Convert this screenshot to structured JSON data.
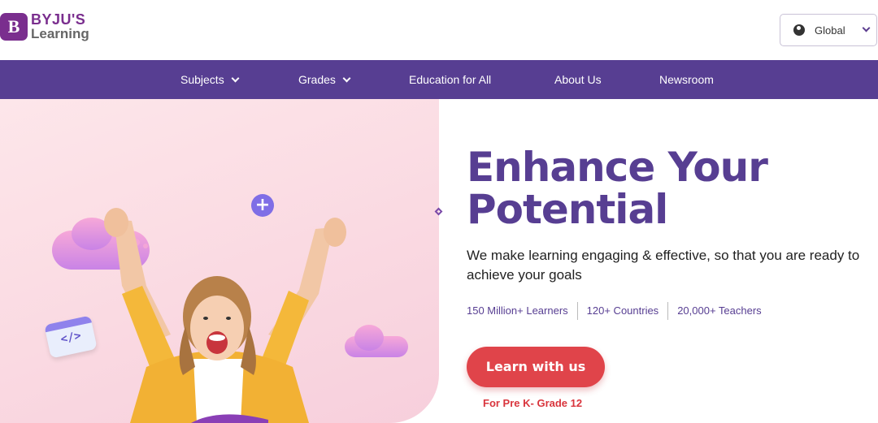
{
  "header": {
    "logo_line1": "BYJU'S",
    "logo_line2": "Learning",
    "logo_badge": "B",
    "region_label": "Global"
  },
  "nav": {
    "items": [
      {
        "label": "Subjects",
        "has_dropdown": true
      },
      {
        "label": "Grades",
        "has_dropdown": true
      },
      {
        "label": "Education for All",
        "has_dropdown": false
      },
      {
        "label": "About Us",
        "has_dropdown": false
      },
      {
        "label": "Newsroom",
        "has_dropdown": false
      }
    ]
  },
  "hero": {
    "title_line1": "Enhance Your",
    "title_line2": "Potential",
    "subtitle": "We make learning engaging & effective, so that you are ready to achieve your goals",
    "stats": [
      "150 Million+ Learners",
      "120+ Countries",
      "20,000+ Teachers"
    ],
    "cta_label": "Learn with us",
    "cta_note": "For Pre K- Grade 12",
    "decor_plus": "+",
    "decor_code": "</>"
  },
  "colors": {
    "brand_purple": "#573e92",
    "logo_purple": "#7a2e8e",
    "cta_red": "#e0444a"
  },
  "icons": [
    "globe-icon",
    "chevron-down-icon",
    "plus-icon",
    "code-icon"
  ]
}
